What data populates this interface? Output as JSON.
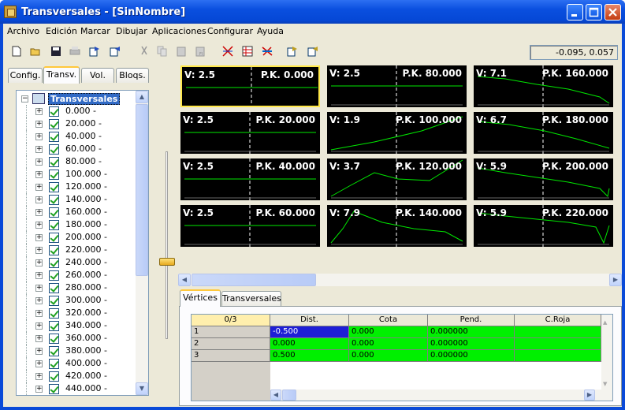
{
  "window": {
    "title": "Transversales - [SinNombre]"
  },
  "menu": [
    "Archivo",
    "Edición",
    "Marcar",
    "Dibujar",
    "Aplicaciones",
    "Configurar",
    "Ayuda"
  ],
  "toolbar": {
    "coords": "-0.095, 0.057"
  },
  "left_tabs": [
    "Config.",
    "Transv.",
    "Vol.",
    "Bloqs."
  ],
  "tree": {
    "root": "Transversales",
    "items": [
      "0.000 -",
      "20.000 -",
      "40.000 -",
      "60.000 -",
      "80.000 -",
      "100.000 -",
      "120.000 -",
      "140.000 -",
      "160.000 -",
      "180.000 -",
      "200.000 -",
      "220.000 -",
      "240.000 -",
      "260.000 -",
      "280.000 -",
      "300.000 -",
      "320.000 -",
      "340.000 -",
      "360.000 -",
      "380.000 -",
      "400.000 -",
      "420.000 -",
      "440.000 -"
    ]
  },
  "sections": [
    {
      "v": "V: 2.5",
      "pk": "P.K. 0.000"
    },
    {
      "v": "V: 2.5",
      "pk": "P.K. 80.000"
    },
    {
      "v": "V: 7.1",
      "pk": "P.K. 160.000"
    },
    {
      "v": "V: 2.5",
      "pk": "P.K. 20.000"
    },
    {
      "v": "V: 1.9",
      "pk": "P.K. 100.000"
    },
    {
      "v": "V: 6.7",
      "pk": "P.K. 180.000"
    },
    {
      "v": "V: 2.5",
      "pk": "P.K. 40.000"
    },
    {
      "v": "V: 3.7",
      "pk": "P.K. 120.000"
    },
    {
      "v": "V: 5.9",
      "pk": "P.K. 200.000"
    },
    {
      "v": "V: 2.5",
      "pk": "P.K. 60.000"
    },
    {
      "v": "V: 7.9",
      "pk": "P.K. 140.000"
    },
    {
      "v": "V: 5.9",
      "pk": "P.K. 220.000"
    }
  ],
  "bottom_tabs": [
    "Vértices",
    "Transversales"
  ],
  "table": {
    "corner": "0/3",
    "columns": [
      "Dist.",
      "Cota",
      "Pend.",
      "C.Roja"
    ],
    "rows": [
      {
        "n": "1",
        "dist": "-0.500",
        "cota": "0.000",
        "pend": "0.000000",
        "croja": ""
      },
      {
        "n": "2",
        "dist": "0.000",
        "cota": "0.000",
        "pend": "0.000000",
        "croja": ""
      },
      {
        "n": "3",
        "dist": "0.500",
        "cota": "0.000",
        "pend": "0.000000",
        "croja": ""
      }
    ]
  }
}
